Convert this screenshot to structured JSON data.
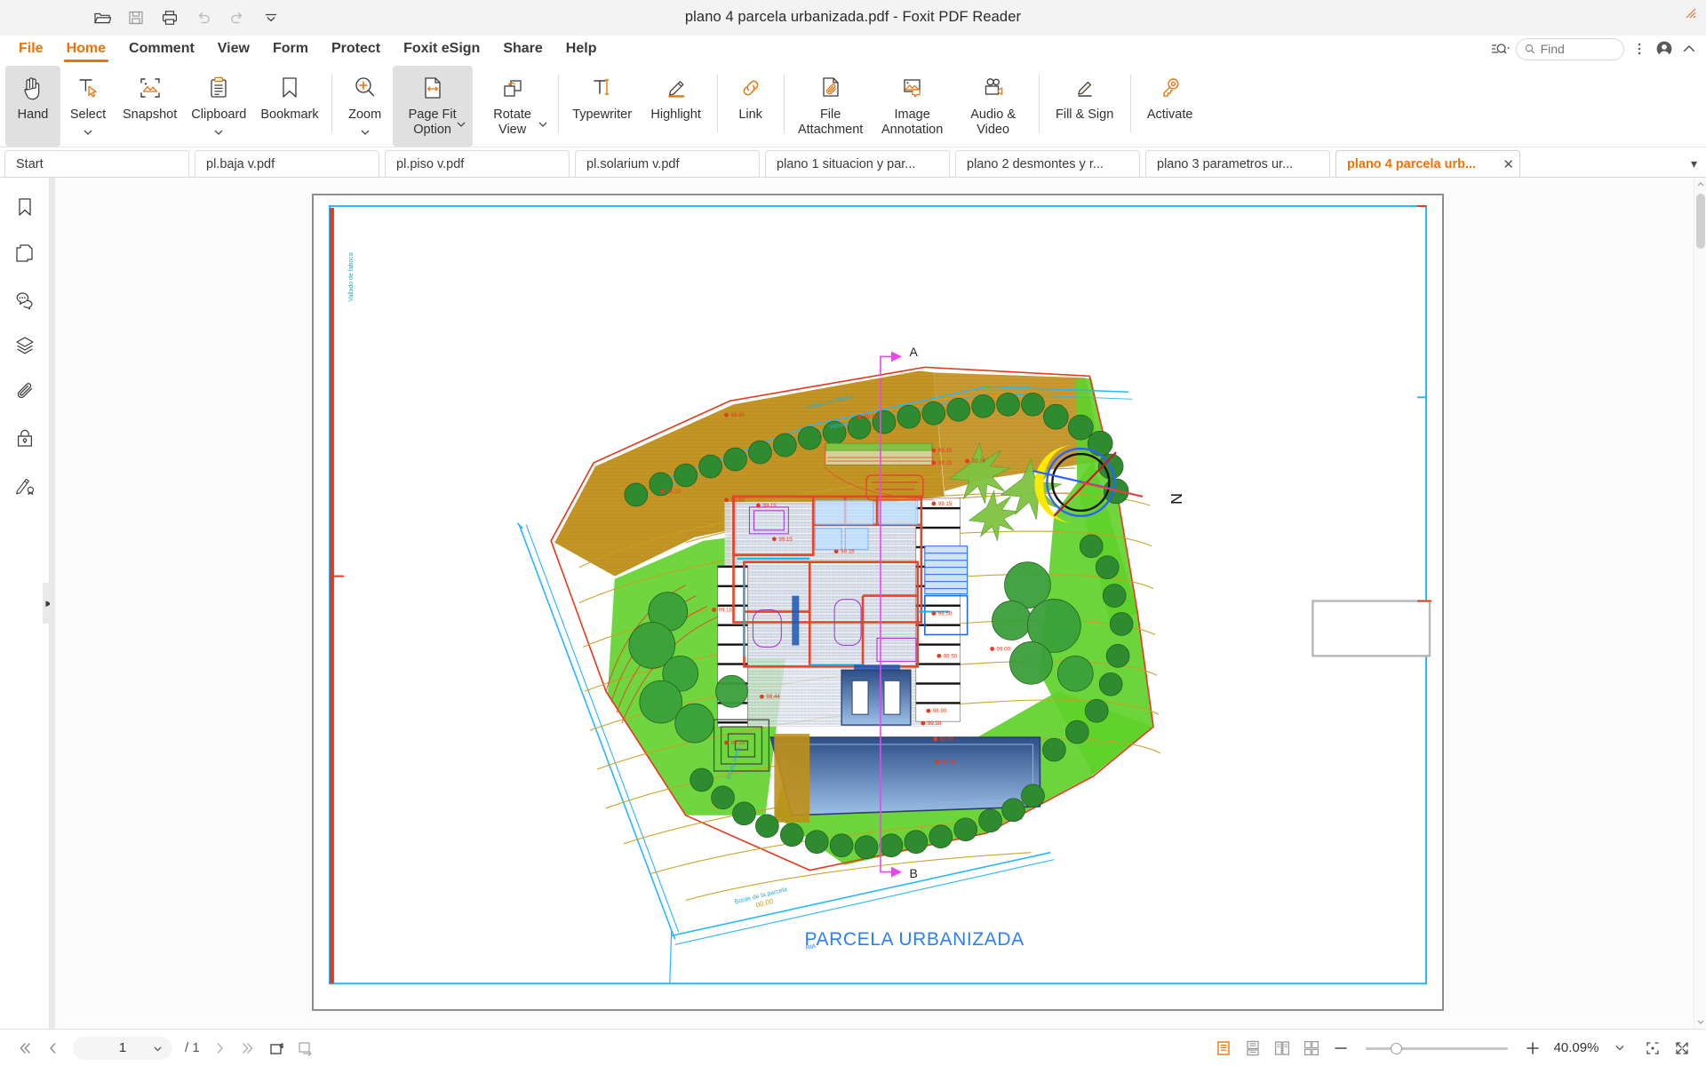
{
  "window": {
    "title": "plano 4 parcela urbanizada.pdf - Foxit PDF Reader",
    "quick_access": [
      {
        "name": "open-icon",
        "label": "Open"
      },
      {
        "name": "save-icon",
        "label": "Save"
      },
      {
        "name": "print-icon",
        "label": "Print"
      },
      {
        "name": "undo-icon",
        "label": "Undo"
      },
      {
        "name": "redo-icon",
        "label": "Redo"
      },
      {
        "name": "customize-icon",
        "label": "Customize Quick Access Toolbar"
      }
    ]
  },
  "menu": {
    "items": [
      {
        "label": "File",
        "state": "accent"
      },
      {
        "label": "Home",
        "state": "active"
      },
      {
        "label": "Comment",
        "state": "normal"
      },
      {
        "label": "View",
        "state": "normal"
      },
      {
        "label": "Form",
        "state": "normal"
      },
      {
        "label": "Protect",
        "state": "normal"
      },
      {
        "label": "Foxit eSign",
        "state": "normal"
      },
      {
        "label": "Share",
        "state": "normal"
      },
      {
        "label": "Help",
        "state": "normal"
      }
    ],
    "search_dropdown_label": "Search options",
    "find_placeholder": "Find",
    "find_value": "",
    "more_label": "More",
    "account_label": "Account",
    "collapse_label": "Collapse ribbon"
  },
  "ribbon": {
    "groups": [
      {
        "buttons": [
          {
            "label": "Hand",
            "icon": "hand-icon",
            "selected": true,
            "caret": false
          },
          {
            "label": "Select",
            "icon": "select-text-icon",
            "selected": false,
            "caret": true
          },
          {
            "label": "Snapshot",
            "icon": "snapshot-icon",
            "selected": false,
            "caret": false
          },
          {
            "label": "Clipboard",
            "icon": "clipboard-icon",
            "selected": false,
            "caret": true
          },
          {
            "label": "Bookmark",
            "icon": "bookmark-icon",
            "selected": false,
            "caret": false
          }
        ]
      },
      {
        "buttons": [
          {
            "label": "Zoom",
            "icon": "zoom-in-icon",
            "selected": false,
            "caret": true
          },
          {
            "label": "Page Fit Option",
            "icon": "page-fit-icon",
            "selected": true,
            "caret": true
          },
          {
            "label": "Rotate View",
            "icon": "rotate-view-icon",
            "selected": false,
            "caret": true
          }
        ]
      },
      {
        "buttons": [
          {
            "label": "Typewriter",
            "icon": "typewriter-icon",
            "selected": false,
            "caret": false
          },
          {
            "label": "Highlight",
            "icon": "highlight-icon",
            "selected": false,
            "caret": false
          }
        ]
      },
      {
        "buttons": [
          {
            "label": "Link",
            "icon": "link-icon",
            "selected": false,
            "caret": false
          }
        ]
      },
      {
        "buttons": [
          {
            "label": "File Attachment",
            "icon": "file-attachment-icon",
            "selected": false,
            "caret": false
          },
          {
            "label": "Image Annotation",
            "icon": "image-annotation-icon",
            "selected": false,
            "caret": false
          },
          {
            "label": "Audio & Video",
            "icon": "audio-video-icon",
            "selected": false,
            "caret": false
          }
        ]
      },
      {
        "buttons": [
          {
            "label": "Fill & Sign",
            "icon": "fill-sign-icon",
            "selected": false,
            "caret": false
          }
        ]
      },
      {
        "buttons": [
          {
            "label": "Activate",
            "icon": "activate-icon",
            "selected": false,
            "caret": false
          }
        ]
      }
    ]
  },
  "doc_tabs": {
    "tabs": [
      {
        "label": "Start",
        "active": false,
        "closable": false
      },
      {
        "label": "pl.baja v.pdf",
        "active": false,
        "closable": false
      },
      {
        "label": "pl.piso v.pdf",
        "active": false,
        "closable": false
      },
      {
        "label": "pl.solarium v.pdf",
        "active": false,
        "closable": false
      },
      {
        "label": "plano 1 situacion y par...",
        "active": false,
        "closable": false
      },
      {
        "label": "plano 2 desmontes y r...",
        "active": false,
        "closable": false
      },
      {
        "label": "plano 3  parametros ur...",
        "active": false,
        "closable": false
      },
      {
        "label": "plano 4 parcela urb...",
        "active": true,
        "closable": true,
        "close_glyph": "✕"
      }
    ],
    "overflow_caret": "▾"
  },
  "left_rail": {
    "items": [
      {
        "name": "bookmarks-panel-icon",
        "label": "Bookmarks"
      },
      {
        "name": "pages-panel-icon",
        "label": "Page Thumbnails"
      },
      {
        "name": "comments-panel-icon",
        "label": "Comments"
      },
      {
        "name": "layers-panel-icon",
        "label": "Layers"
      },
      {
        "name": "attachments-panel-icon",
        "label": "Attachments"
      },
      {
        "name": "security-panel-icon",
        "label": "Security"
      },
      {
        "name": "signatures-panel-icon",
        "label": "Digital Signatures"
      }
    ],
    "expander_glyph": "▶"
  },
  "document": {
    "drawing_title": "PARCELA URBANIZADA",
    "section_markers": [
      {
        "label": "A",
        "position": "top"
      },
      {
        "label": "B",
        "position": "bottom"
      }
    ],
    "north_label": "N",
    "elevation_marks": [
      "98.80",
      "98.83",
      "99.06",
      "98.15",
      "99.15",
      "99.15",
      "99.16",
      "99.15",
      "99.18",
      "99.15",
      "99.00",
      "99.50",
      "99.30",
      "98.50",
      "98.44",
      "98.90",
      "99.35",
      "98.69",
      "98.78",
      "90.69",
      "99.24"
    ],
    "boundary_labels": [
      "Vallado de fabrica",
      "Vallado",
      "Borde de la parcela",
      "Borde acera",
      "00.20",
      "00.00",
      "RIA"
    ]
  },
  "status_bar": {
    "first_page_label": "First Page",
    "prev_page_label": "Previous Page",
    "page_number": "1",
    "page_total": "/ 1",
    "next_page_label": "Next Page",
    "last_page_label": "Last Page",
    "previous_view_label": "Previous View",
    "next_view_label": "Next View",
    "view_modes": [
      {
        "name": "single-page-view-icon",
        "label": "Single Page",
        "active": true
      },
      {
        "name": "continuous-view-icon",
        "label": "Continuous",
        "active": false
      },
      {
        "name": "facing-view-icon",
        "label": "Facing",
        "active": false
      },
      {
        "name": "facing-continuous-view-icon",
        "label": "Facing Continuous",
        "active": false
      }
    ],
    "zoom_out_label": "Zoom Out",
    "zoom_in_label": "Zoom In",
    "zoom_level": "40.09%",
    "zoom_caret": "▾",
    "loupe_label": "Loupe Tool",
    "fullscreen_label": "Full Screen"
  },
  "colors": {
    "accent": "#e8740c",
    "plot_label_blue": "#2e80f2",
    "parcel_green": "#5fd12a",
    "parcel_ochre": "#c08f19",
    "tree_green": "#2f8b2f",
    "wall_red": "#e8442a",
    "pool_blue": "#5a7fb8",
    "section_magenta": "#ee44ee",
    "contour_gold": "#c8a020"
  }
}
